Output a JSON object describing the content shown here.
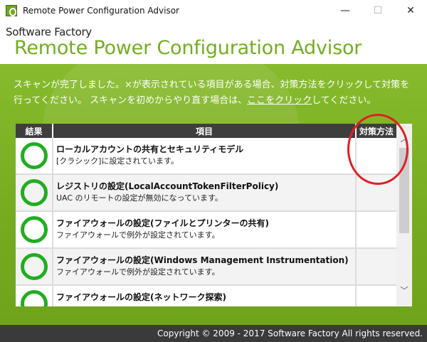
{
  "window": {
    "title": "Remote Power Configuration Advisor",
    "controls": {
      "minimize": "—",
      "maximize": "☐",
      "close": "✕"
    }
  },
  "header": {
    "brand": "Software Factory",
    "title": "Remote Power Configuration Advisor"
  },
  "instructions": {
    "text_before_link": "スキャンが完了しました。×が表示されている項目がある場合、対策方法をクリックして対策を行ってください。 スキャンを初めからやり直す場合は、",
    "link": "ここをクリック",
    "text_after_link": "してください。"
  },
  "table": {
    "headers": {
      "result": "結果",
      "item": "項目",
      "action": "対策方法"
    },
    "rows": [
      {
        "status": "ok",
        "title": "ローカルアカウントの共有とセキュリティモデル",
        "desc": "[クラシック]に設定されています。"
      },
      {
        "status": "ok",
        "title": "レジストリの設定(LocalAccountTokenFilterPolicy)",
        "desc": "UAC のリモートの設定が無効になっています。"
      },
      {
        "status": "ok",
        "title": "ファイアウォールの設定(ファイルとプリンターの共有)",
        "desc": "ファイアウォールで例外が設定されています。"
      },
      {
        "status": "ok",
        "title": "ファイアウォールの設定(Windows Management Instrumentation)",
        "desc": "ファイアウォールで例外が設定されています。"
      },
      {
        "status": "ok",
        "title": "ファイアウォールの設定(ネットワーク探索)",
        "desc": ""
      }
    ]
  },
  "footer": {
    "copyright": "Copyright © 2009 - 2017 Software Factory All rights reserved."
  },
  "colors": {
    "brand_green": "#74ad22",
    "main_bg": "#7ab223",
    "ok_green": "#21ad21",
    "annotation_red": "#e01f26",
    "footer_bg": "#3a3a3a"
  }
}
